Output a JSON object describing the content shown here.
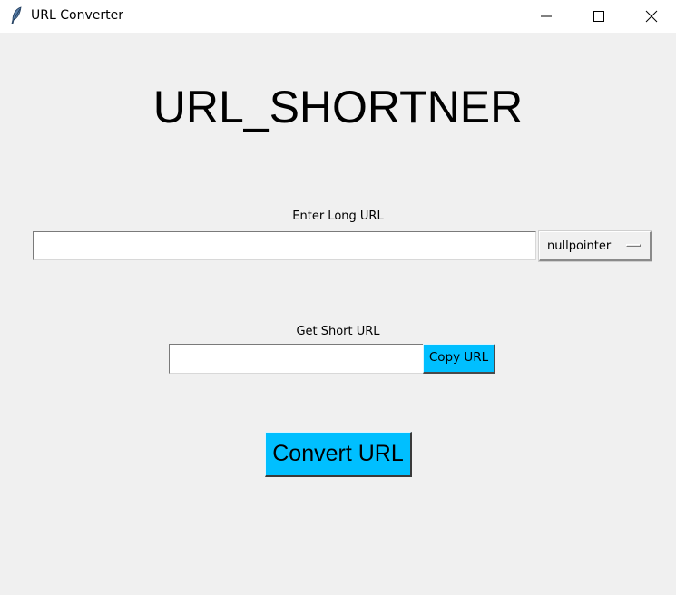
{
  "window": {
    "title": "URL Converter",
    "icon": "feather-icon",
    "controls": [
      "minimize-icon",
      "maximize-icon",
      "close-icon"
    ]
  },
  "main": {
    "heading": "URL_SHORTNER",
    "long_url_label": "Enter Long URL",
    "long_url_value": "",
    "service_selected": "nullpointer",
    "short_url_label": "Get Short URL",
    "short_url_value": "",
    "copy_button_label": "Copy URL",
    "convert_button_label": "Convert URL"
  },
  "colors": {
    "background": "#f0f0f0",
    "button_accent": "#00bfff",
    "titlebar": "#ffffff"
  }
}
